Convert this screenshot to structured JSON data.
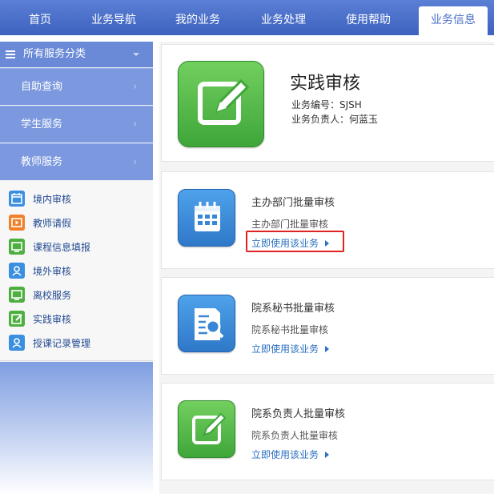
{
  "nav": {
    "tabs": [
      "首页",
      "业务导航",
      "我的业务",
      "业务处理",
      "使用帮助",
      "业务信息"
    ],
    "active_index": 5
  },
  "sidebar": {
    "header": "所有服务分类",
    "categories": [
      "自助查询",
      "学生服务",
      "教师服务"
    ],
    "category_arrow": "›",
    "items": [
      {
        "label": "境内审核",
        "icon": "calendar-icon",
        "color": "#3b8fe0"
      },
      {
        "label": "教师请假",
        "icon": "play-icon",
        "color": "#f0802a"
      },
      {
        "label": "课程信息填报",
        "icon": "monitor-icon",
        "color": "#4caf3f"
      },
      {
        "label": "境外审核",
        "icon": "person-icon",
        "color": "#3b8fe0"
      },
      {
        "label": "离校服务",
        "icon": "monitor-icon",
        "color": "#4caf3f"
      },
      {
        "label": "实践审核",
        "icon": "edit-icon",
        "color": "#4caf3f"
      },
      {
        "label": "授课记录管理",
        "icon": "person-icon",
        "color": "#3b8fe0"
      }
    ]
  },
  "service": {
    "title": "实践审核",
    "code": "业务编号：SJSH",
    "owner": "业务负责人：何蓝玉",
    "icon": "edit-icon"
  },
  "cards": [
    {
      "title": "主办部门批量审核",
      "subtitle": "主办部门批量审核",
      "link": "立即使用该业务",
      "icon": "calendar-icon",
      "color": "blue",
      "highlighted": true
    },
    {
      "title": "院系秘书批量审核",
      "subtitle": "院系秘书批量审核",
      "link": "立即使用该业务",
      "icon": "document-search-icon",
      "color": "blue",
      "highlighted": false
    },
    {
      "title": "院系负责人批量审核",
      "subtitle": "院系负责人批量审核",
      "link": "立即使用该业务",
      "icon": "edit-icon",
      "color": "green",
      "highlighted": false
    }
  ],
  "colors": {
    "nav_bg": "#3d62bf",
    "sidebar_header": "#6a8ad8",
    "sidebar_category": "#7c99df",
    "link": "#2a6fc0",
    "highlight_border": "#e02222"
  }
}
